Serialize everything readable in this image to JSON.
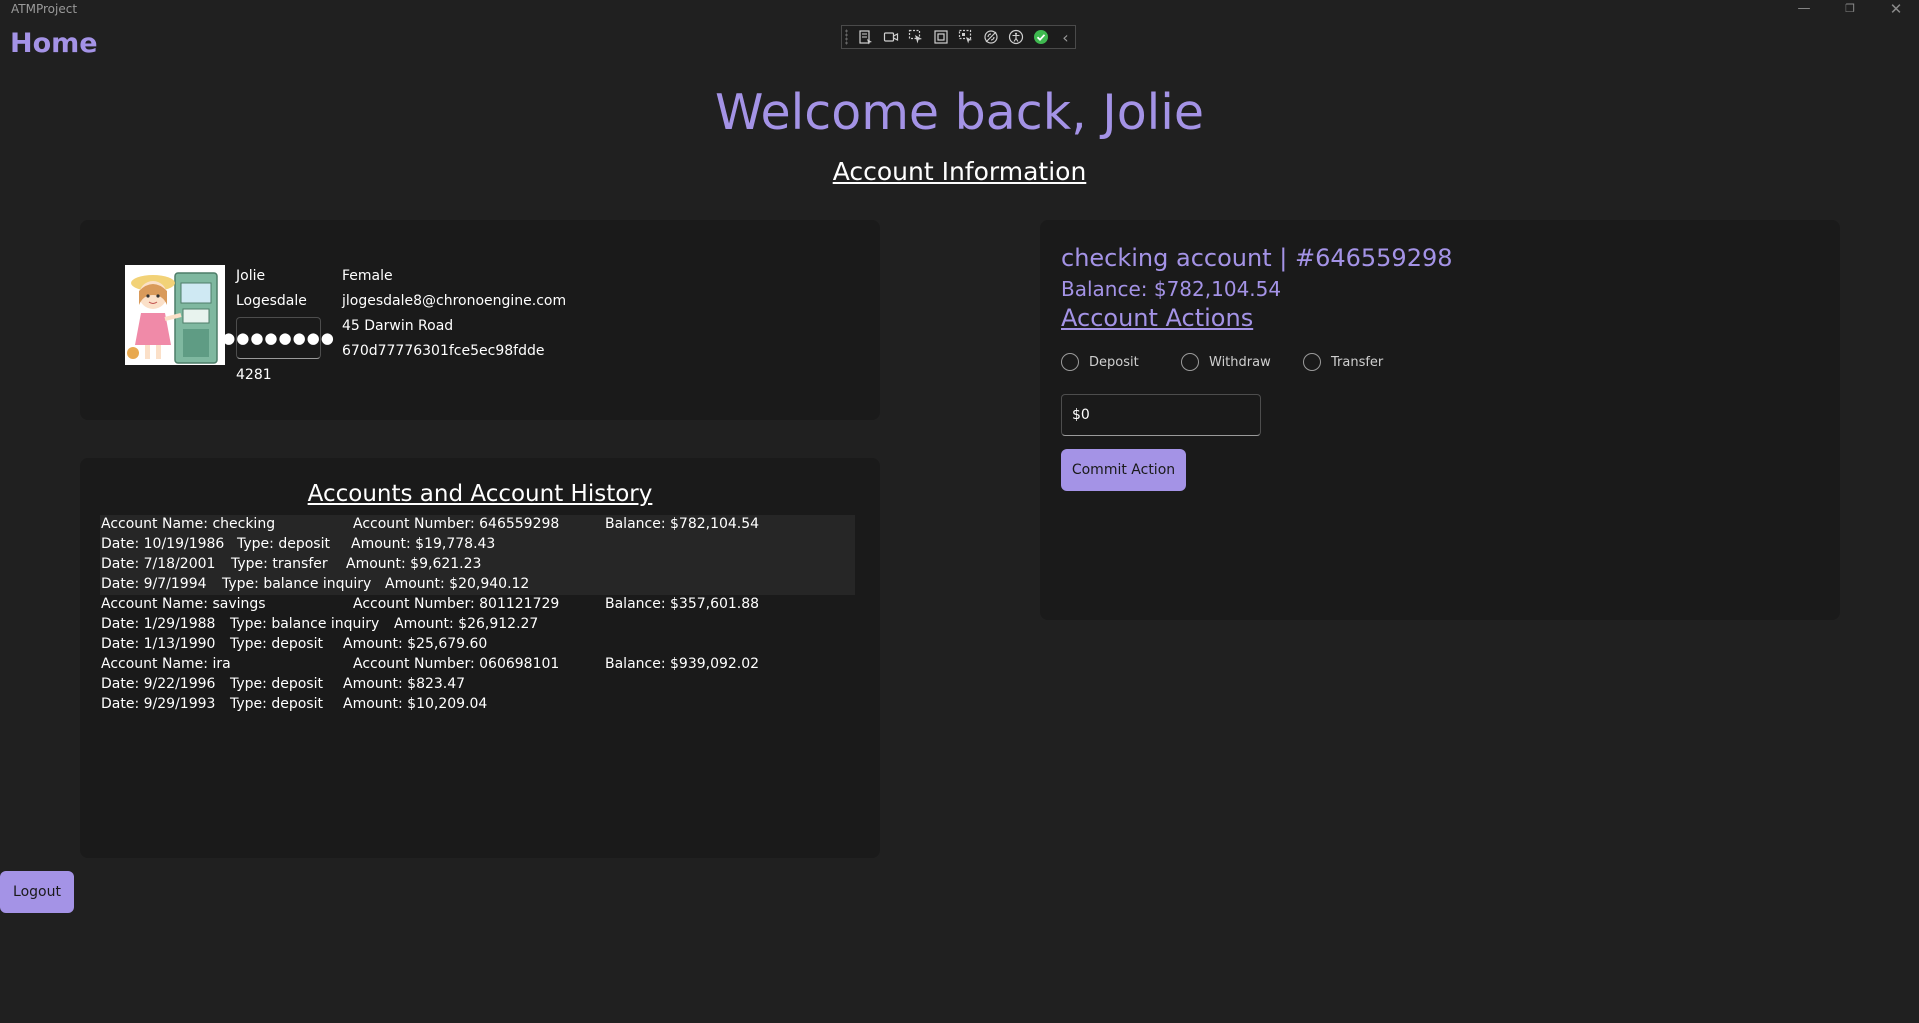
{
  "window": {
    "title": "ATMProject",
    "minimize_glyph": "—",
    "maximize_glyph": "❐",
    "close_glyph": "✕"
  },
  "page": {
    "heading": "Home"
  },
  "dev_toolbar": {
    "icons": [
      "live-visual-tree-icon",
      "record-icon",
      "select-element-icon",
      "display-layout-adorners-icon",
      "track-focus-icon",
      "binding-failures-icon",
      "accessibility-icon",
      "checkmark-icon",
      "collapse-chevron-icon"
    ],
    "collapse_glyph": "‹"
  },
  "welcome": "Welcome back, Jolie",
  "account_info_heading": "Account Information",
  "profile": {
    "first_name": "Jolie",
    "last_name": "Logesdale",
    "password_mask": "●●●●●●●●",
    "pin": "4281",
    "gender": "Female",
    "email": "jlogesdale8@chronoengine.com",
    "address": "45 Darwin Road",
    "id": "670d77776301fce5ec98fdde"
  },
  "history": {
    "title": "Accounts and Account History",
    "accounts": [
      {
        "name": "Account Name: checking",
        "number": "Account Number: 646559298",
        "balance": "Balance: $782,104.54",
        "transactions": [
          {
            "date": "Date: 10/19/1986",
            "type": "Type: deposit",
            "amount": "Amount: $19,778.43"
          },
          {
            "date": "Date: 7/18/2001",
            "type": "Type: transfer",
            "amount": "Amount: $9,621.23"
          },
          {
            "date": "Date: 9/7/1994",
            "type": "Type: balance inquiry",
            "amount": "Amount: $20,940.12"
          }
        ]
      },
      {
        "name": "Account Name: savings",
        "number": "Account Number: 801121729",
        "balance": "Balance: $357,601.88",
        "transactions": [
          {
            "date": "Date: 1/29/1988",
            "type": "Type: balance inquiry",
            "amount": "Amount: $26,912.27"
          },
          {
            "date": "Date: 1/13/1990",
            "type": "Type: deposit",
            "amount": "Amount: $25,679.60"
          }
        ]
      },
      {
        "name": "Account Name: ira",
        "number": "Account Number: 060698101",
        "balance": "Balance: $939,092.02",
        "transactions": [
          {
            "date": "Date: 9/22/1996",
            "type": "Type: deposit",
            "amount": "Amount: $823.47"
          },
          {
            "date": "Date: 9/29/1993",
            "type": "Type: deposit",
            "amount": "Amount: $10,209.04"
          }
        ]
      }
    ]
  },
  "actions": {
    "title": "checking account | #646559298",
    "balance": "Balance: $782,104.54",
    "heading": "Account Actions",
    "options": [
      "Deposit",
      "Withdraw",
      "Transfer"
    ],
    "amount_value": "$0",
    "commit_label": "Commit Action"
  },
  "logout_label": "Logout",
  "colors": {
    "accent": "#a493e6",
    "background": "#202020",
    "panel": "#1a1a1a"
  }
}
